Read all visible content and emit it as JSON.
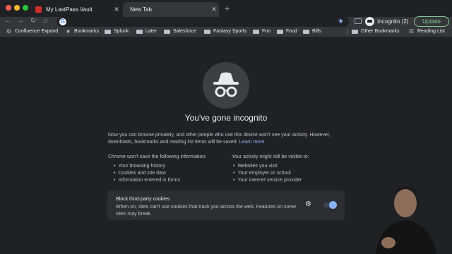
{
  "tabs": [
    {
      "title": "My LastPass Vault",
      "active": false
    },
    {
      "title": "New Tab",
      "active": true
    }
  ],
  "toolbar": {
    "profile_label": "Incognito (2)",
    "update_label": "Update",
    "omnibox_value": ""
  },
  "bookmarks": {
    "items": [
      {
        "label": "Confluence Expand",
        "icon": "gear-icon"
      },
      {
        "label": "Bookmarks",
        "icon": "star-icon"
      },
      {
        "label": "Splunk",
        "icon": "folder-icon"
      },
      {
        "label": "Later",
        "icon": "folder-icon"
      },
      {
        "label": "Salesforce",
        "icon": "folder-icon"
      },
      {
        "label": "Fantasy Sports",
        "icon": "folder-icon"
      },
      {
        "label": "Fun",
        "icon": "folder-icon"
      },
      {
        "label": "Food",
        "icon": "folder-icon"
      },
      {
        "label": "Bills",
        "icon": "folder-icon"
      }
    ],
    "other": "Other Bookmarks",
    "reading_list": "Reading List"
  },
  "incognito": {
    "headline": "You've gone incognito",
    "intro": "Now you can browse privately, and other people who use this device won't see your activity. However, downloads, bookmarks and reading list items will be saved.",
    "learn_more": "Learn more",
    "left_heading": "Chrome won't save the following information:",
    "left_items": [
      "Your browsing history",
      "Cookies and site data",
      "Information entered in forms"
    ],
    "right_heading": "Your activity might still be visible to:",
    "right_items": [
      "Websites you visit",
      "Your employer or school",
      "Your internet service provider"
    ]
  },
  "cookie_card": {
    "title": "Block third-party cookies",
    "description": "When on, sites can't use cookies that track you across the web. Features on some sites may break.",
    "toggle_on": true
  },
  "colors": {
    "background": "#202124",
    "toolbar": "#35363a",
    "accent": "#8ab4f8",
    "update_green": "#81c995"
  }
}
